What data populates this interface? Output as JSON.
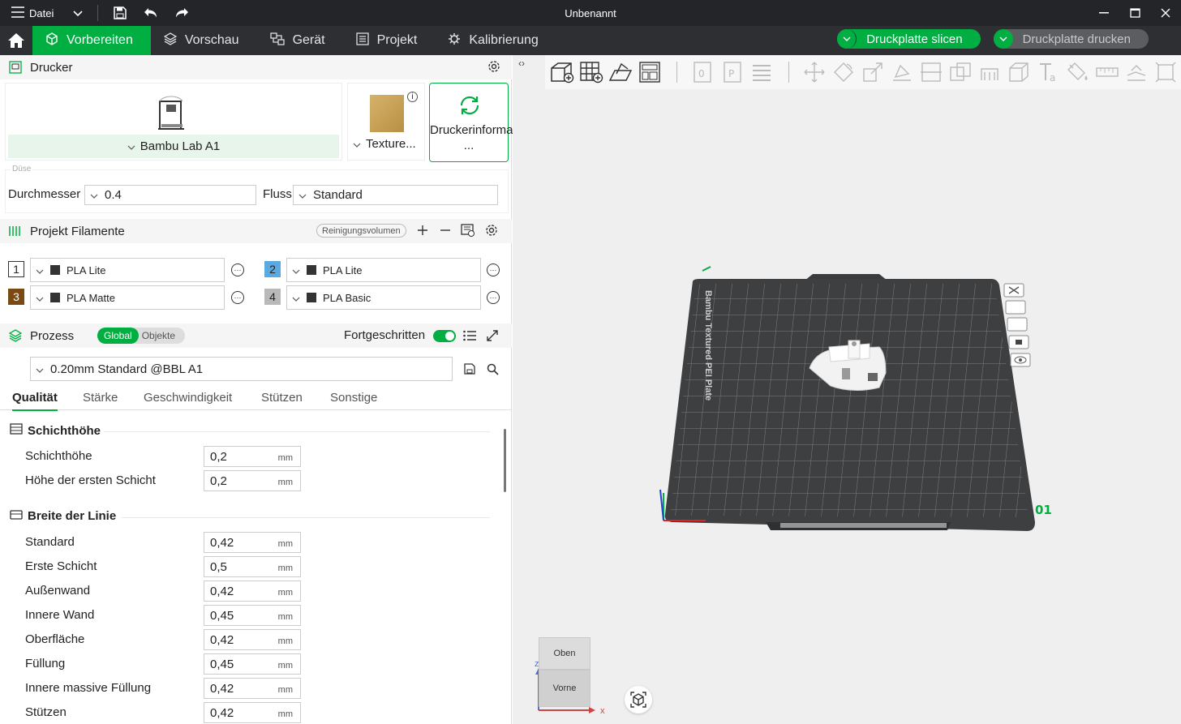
{
  "window": {
    "menu_label": "Datei",
    "title": "Unbenannt"
  },
  "nav": {
    "tabs": [
      {
        "label": "Vorbereiten",
        "icon": "cube-icon",
        "active": true
      },
      {
        "label": "Vorschau",
        "icon": "layers-icon",
        "active": false
      },
      {
        "label": "Gerät",
        "icon": "device-icon",
        "active": false
      },
      {
        "label": "Projekt",
        "icon": "project-icon",
        "active": false
      },
      {
        "label": "Kalibrierung",
        "icon": "calibration-icon",
        "active": false
      }
    ],
    "slice_button": "Druckplatte slicen",
    "print_button": "Druckplatte drucken"
  },
  "printer": {
    "section_title": "Drucker",
    "printer_name": "Bambu Lab A1",
    "plate_name": "Texture...",
    "info_button": "Druckerinformationen ...",
    "nozzle_legend": "Düse",
    "diameter_label": "Durchmesser",
    "diameter_value": "0.4",
    "flow_label": "Fluss",
    "flow_value": "Standard"
  },
  "filaments": {
    "section_title": "Projekt Filamente",
    "purge_button": "Reinigungsvolumen",
    "items": [
      {
        "num": "1",
        "name": "PLA Lite",
        "color": "#ffffff"
      },
      {
        "num": "2",
        "name": "PLA Lite",
        "color": "#5aa9e0"
      },
      {
        "num": "3",
        "name": "PLA Matte",
        "color": "#7a4a12"
      },
      {
        "num": "4",
        "name": "PLA Basic",
        "color": "#b9b9b9"
      }
    ]
  },
  "process": {
    "section_title": "Prozess",
    "scope_global": "Global",
    "scope_objects": "Objekte",
    "advanced_label": "Fortgeschritten",
    "advanced_on": true,
    "preset": "0.20mm Standard @BBL A1",
    "tabs": [
      "Qualität",
      "Stärke",
      "Geschwindigkeit",
      "Stützen",
      "Sonstige"
    ],
    "active_tab": "Qualität",
    "groups": [
      {
        "title": "Schichthöhe",
        "params": [
          {
            "label": "Schichthöhe",
            "value": "0,2",
            "unit": "mm"
          },
          {
            "label": "Höhe der ersten Schicht",
            "value": "0,2",
            "unit": "mm"
          }
        ]
      },
      {
        "title": "Breite der Linie",
        "params": [
          {
            "label": "Standard",
            "value": "0,42",
            "unit": "mm"
          },
          {
            "label": "Erste Schicht",
            "value": "0,5",
            "unit": "mm"
          },
          {
            "label": "Außenwand",
            "value": "0,42",
            "unit": "mm"
          },
          {
            "label": "Innere Wand",
            "value": "0,45",
            "unit": "mm"
          },
          {
            "label": "Oberfläche",
            "value": "0,42",
            "unit": "mm"
          },
          {
            "label": "Füllung",
            "value": "0,45",
            "unit": "mm"
          },
          {
            "label": "Innere massive Füllung",
            "value": "0,42",
            "unit": "mm"
          },
          {
            "label": "Stützen",
            "value": "0,42",
            "unit": "mm"
          }
        ]
      }
    ]
  },
  "viewport": {
    "plate_number": "01",
    "plate_text": "Bambu Textured PEI Plate",
    "view_top": "Oben",
    "view_front": "Vorne",
    "axis_x": "x",
    "axis_z": "z",
    "accent_color": "#00ae42"
  }
}
